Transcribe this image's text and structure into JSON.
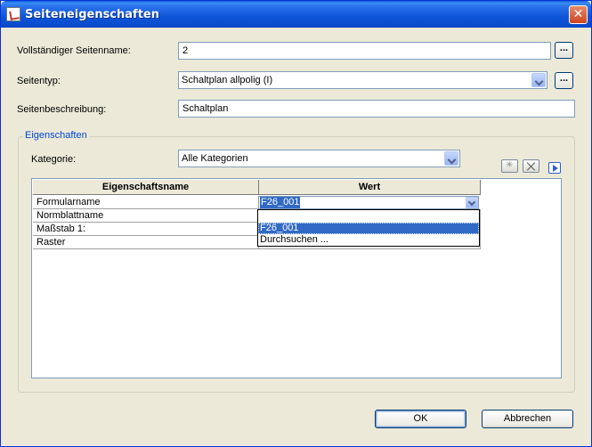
{
  "window": {
    "title": "Seiteneigenschaften",
    "close_glyph": "✕"
  },
  "form": {
    "full_name_label": "Vollständiger Seitenname:",
    "full_name_value": "2",
    "page_type_label": "Seitentyp:",
    "page_type_value": "Schaltplan allpolig (I)",
    "description_label": "Seitenbeschreibung:",
    "description_value": "Schaltplan",
    "browse_label": "..."
  },
  "properties": {
    "group_title": "Eigenschaften",
    "category_label": "Kategorie:",
    "category_value": "Alle Kategorien",
    "toolbar_icons": [
      "new-icon",
      "delete-icon",
      "play-icon"
    ],
    "columns": [
      "Eigenschaftsname",
      "Wert"
    ],
    "rows": [
      {
        "name": "Formularname",
        "value": ""
      },
      {
        "name": "Normblattname",
        "value": ""
      },
      {
        "name": "Maßstab 1:",
        "value": ""
      },
      {
        "name": "Raster",
        "value": ""
      }
    ],
    "editing_value": "F26_001",
    "dropdown_options": [
      "",
      "F26_001",
      "Durchsuchen ..."
    ],
    "dropdown_selected": "F26_001"
  },
  "footer": {
    "ok_label": "OK",
    "cancel_label": "Abbrechen"
  },
  "colors": {
    "titlebar": "#0a5fde",
    "selection": "#316ac5",
    "group_title": "#0046d5",
    "dialog_bg": "#ece9d8"
  }
}
